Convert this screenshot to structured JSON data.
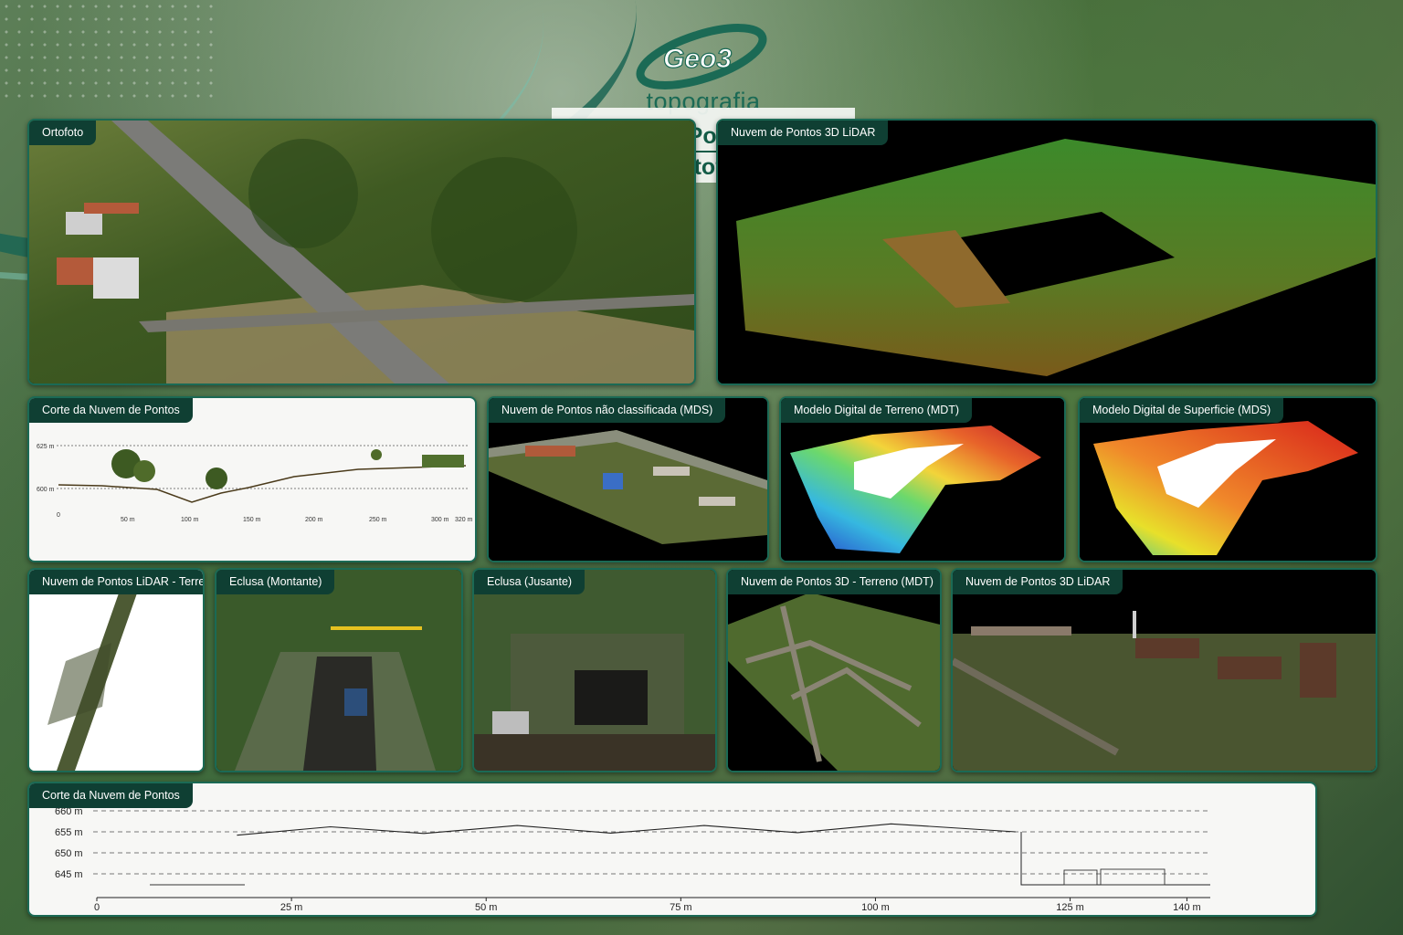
{
  "logo": {
    "mark": "Geo3",
    "subtitle": "topografia"
  },
  "title": {
    "line1": "Nuvens de Pontos LiDAR",
    "line2": "e Ortofoto"
  },
  "panels": {
    "ortofoto": "Ortofoto",
    "lidar3d_top": "Nuvem de Pontos 3D LiDAR",
    "corte_small": "Corte da Nuvem de Pontos",
    "nao_classificada": "Nuvem de Pontos não classificada (MDS)",
    "mdt": "Modelo Digital de Terreno (MDT)",
    "mds": "Modelo Digital de Superficie (MDS)",
    "terrestre": "Nuvem de Pontos LiDAR - Terrestre",
    "eclusa_montante": "Eclusa (Montante)",
    "eclusa_jusante": "Eclusa (Jusante)",
    "terreno3d": "Nuvem de Pontos 3D - Terreno (MDT)",
    "lidar3d_bottom": "Nuvem de Pontos 3D LiDAR",
    "corte_large": "Corte da Nuvem de Pontos"
  },
  "profile_small": {
    "y_labels": [
      "625 m",
      "600 m"
    ],
    "x_labels": [
      "0",
      "50 m",
      "100 m",
      "150 m",
      "200 m",
      "250 m",
      "300 m",
      "320 m"
    ]
  },
  "profile_large": {
    "y_labels": [
      "660 m",
      "655 m",
      "650 m",
      "645 m"
    ],
    "x_labels": [
      "0",
      "25 m",
      "50 m",
      "75 m",
      "100 m",
      "125 m",
      "140 m"
    ]
  },
  "chart_data": {
    "type": "line",
    "title": "Corte da Nuvem de Pontos",
    "xlabel": "",
    "ylabel": "",
    "xlim": [
      0,
      143
    ],
    "ylim": [
      641,
      661
    ],
    "series": [
      {
        "x": [
          18,
          30,
          42,
          54,
          66,
          78,
          90,
          102,
          118
        ],
        "values": [
          654.2,
          656.2,
          654.6,
          656.5,
          654.7,
          656.5,
          654.8,
          656.9,
          655.0
        ]
      }
    ],
    "grid": true
  },
  "colors": {
    "accent": "#1b6a55",
    "tag_bg": "#0f3f33",
    "title": "#145c47"
  }
}
